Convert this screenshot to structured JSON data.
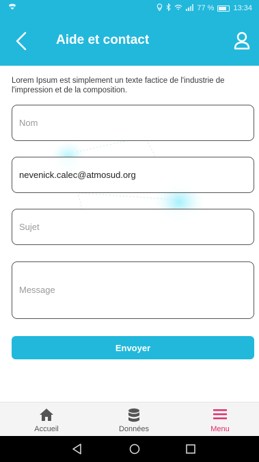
{
  "status_bar": {
    "battery_percent": "77 %",
    "time": "13:34",
    "icons": [
      "notification-icon",
      "location-icon",
      "bluetooth-icon",
      "wifi-icon",
      "signal-icon",
      "battery-icon"
    ]
  },
  "header": {
    "title": "Aide et contact",
    "back_icon": "chevron-left-icon",
    "profile_icon": "user-icon"
  },
  "intro_text": "Lorem Ipsum est simplement un texte factice de l'industrie de l'impression et de la composition.",
  "form": {
    "name": {
      "placeholder": "Nom",
      "value": ""
    },
    "email": {
      "placeholder": "",
      "value": "nevenick.calec@atmosud.org"
    },
    "subject": {
      "placeholder": "Sujet",
      "value": ""
    },
    "message": {
      "placeholder": "Message",
      "value": ""
    },
    "submit_label": "Envoyer"
  },
  "bottom_nav": {
    "items": [
      {
        "label": "Accueil",
        "icon": "home-icon",
        "active": false
      },
      {
        "label": "Données",
        "icon": "database-icon",
        "active": false
      },
      {
        "label": "Menu",
        "icon": "hamburger-menu-icon",
        "active": true
      }
    ]
  },
  "colors": {
    "primary": "#22b8dc",
    "active_nav": "#e3296a",
    "text": "#222222"
  }
}
